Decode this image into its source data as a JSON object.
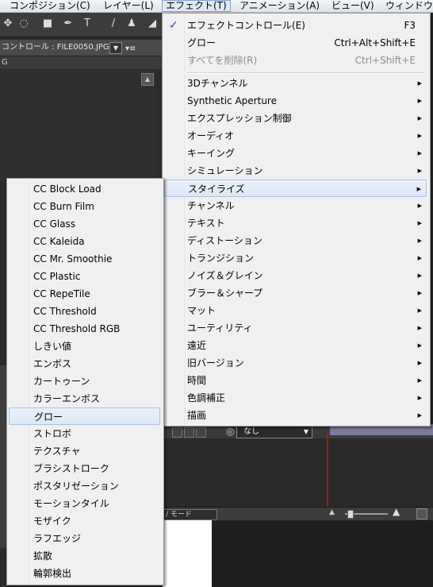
{
  "menubar": {
    "items": [
      {
        "label": "コンポジション(C)",
        "active": false
      },
      {
        "label": "レイヤー(L)",
        "active": false
      },
      {
        "label": "エフェクト(T)",
        "active": true
      },
      {
        "label": "アニメーション(A)",
        "active": false
      },
      {
        "label": "ビュー(V)",
        "active": false
      },
      {
        "label": "ウィンドウ",
        "active": false
      }
    ]
  },
  "panel": {
    "tab_label": "コントロール : FILE0050.JPG",
    "sub_label": "G",
    "dropdown_icon": "triangle-down",
    "menu_icon": "panel-menu"
  },
  "timeline": {
    "select_value": "なし",
    "mode_label": "/ モード"
  },
  "effect_menu": {
    "items": [
      {
        "label": "エフェクトコントロール(E)",
        "shortcut": "F3",
        "checked": true
      },
      {
        "label": "グロー",
        "shortcut": "Ctrl+Alt+Shift+E"
      },
      {
        "label": "すべてを削除(R)",
        "shortcut": "Ctrl+Shift+E",
        "disabled": true
      }
    ],
    "categories": [
      {
        "label": "3Dチャンネル"
      },
      {
        "label": "Synthetic Aperture"
      },
      {
        "label": "エクスプレッション制御"
      },
      {
        "label": "オーディオ"
      },
      {
        "label": "キーイング"
      },
      {
        "label": "シミュレーション"
      },
      {
        "label": "スタイライズ",
        "highlighted": true
      },
      {
        "label": "チャンネル"
      },
      {
        "label": "テキスト"
      },
      {
        "label": "ディストーション"
      },
      {
        "label": "トランジション"
      },
      {
        "label": "ノイズ＆グレイン"
      },
      {
        "label": "ブラー＆シャープ"
      },
      {
        "label": "マット"
      },
      {
        "label": "ユーティリティ"
      },
      {
        "label": "遠近"
      },
      {
        "label": "旧バージョン"
      },
      {
        "label": "時間"
      },
      {
        "label": "色調補正"
      },
      {
        "label": "描画"
      }
    ]
  },
  "stylize_submenu": {
    "items": [
      {
        "label": "CC Block Load"
      },
      {
        "label": "CC Burn Film"
      },
      {
        "label": "CC Glass"
      },
      {
        "label": "CC Kaleida"
      },
      {
        "label": "CC Mr. Smoothie"
      },
      {
        "label": "CC Plastic"
      },
      {
        "label": "CC RepeTile"
      },
      {
        "label": "CC Threshold"
      },
      {
        "label": "CC Threshold RGB"
      },
      {
        "label": "しきい値"
      },
      {
        "label": "エンボス"
      },
      {
        "label": "カートゥーン"
      },
      {
        "label": "カラーエンボス"
      },
      {
        "label": "グロー",
        "highlighted": true
      },
      {
        "label": "ストロボ"
      },
      {
        "label": "テクスチャ"
      },
      {
        "label": "ブラシストローク"
      },
      {
        "label": "ポスタリゼーション"
      },
      {
        "label": "モーションタイル"
      },
      {
        "label": "モザイク"
      },
      {
        "label": "ラフエッジ"
      },
      {
        "label": "拡散"
      },
      {
        "label": "輪郭検出"
      }
    ]
  },
  "icons": {
    "checkmark": "✓",
    "submenu_arrow": "▶",
    "swirl": "◎"
  },
  "colors": {
    "menu_bg": "#f0f0f0",
    "highlight_bg": "#dde8f5",
    "highlight_border": "#a9c4e6",
    "app_bg": "#2b2b2b"
  }
}
